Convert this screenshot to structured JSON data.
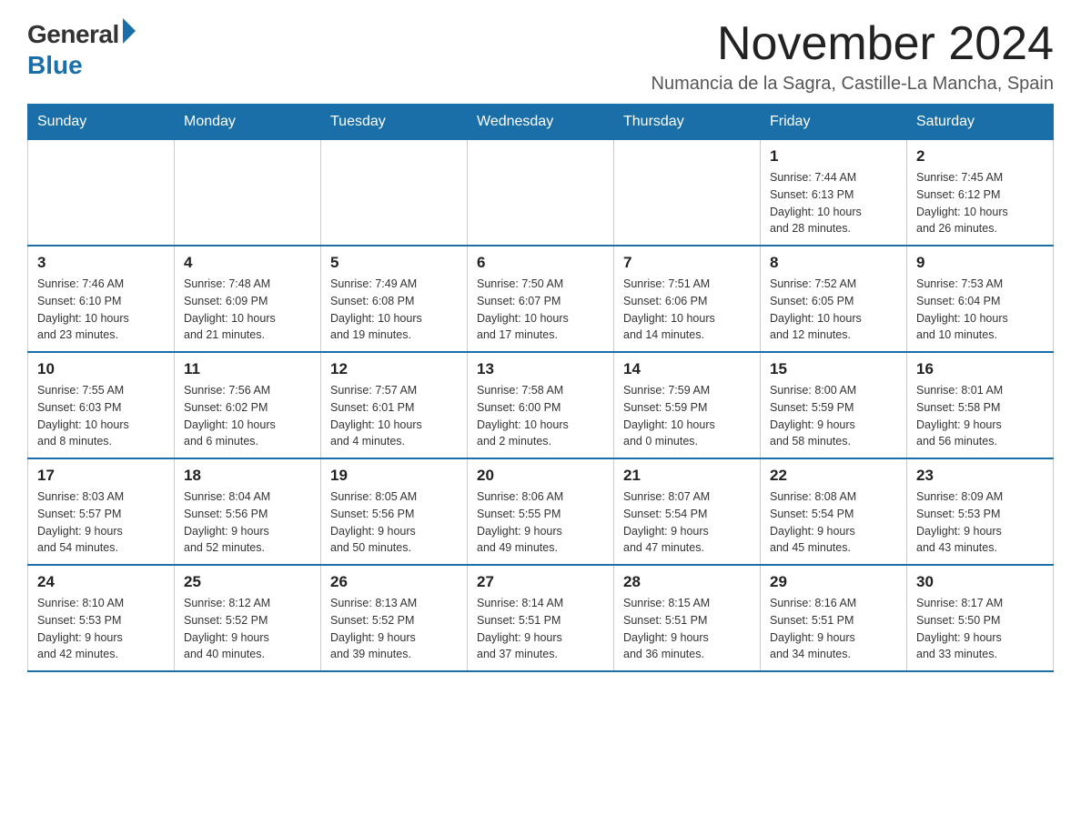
{
  "header": {
    "logo_general": "General",
    "logo_blue": "Blue",
    "main_title": "November 2024",
    "subtitle": "Numancia de la Sagra, Castille-La Mancha, Spain"
  },
  "calendar": {
    "days_of_week": [
      "Sunday",
      "Monday",
      "Tuesday",
      "Wednesday",
      "Thursday",
      "Friday",
      "Saturday"
    ],
    "weeks": [
      {
        "days": [
          {
            "number": "",
            "info": ""
          },
          {
            "number": "",
            "info": ""
          },
          {
            "number": "",
            "info": ""
          },
          {
            "number": "",
            "info": ""
          },
          {
            "number": "",
            "info": ""
          },
          {
            "number": "1",
            "info": "Sunrise: 7:44 AM\nSunset: 6:13 PM\nDaylight: 10 hours\nand 28 minutes."
          },
          {
            "number": "2",
            "info": "Sunrise: 7:45 AM\nSunset: 6:12 PM\nDaylight: 10 hours\nand 26 minutes."
          }
        ]
      },
      {
        "days": [
          {
            "number": "3",
            "info": "Sunrise: 7:46 AM\nSunset: 6:10 PM\nDaylight: 10 hours\nand 23 minutes."
          },
          {
            "number": "4",
            "info": "Sunrise: 7:48 AM\nSunset: 6:09 PM\nDaylight: 10 hours\nand 21 minutes."
          },
          {
            "number": "5",
            "info": "Sunrise: 7:49 AM\nSunset: 6:08 PM\nDaylight: 10 hours\nand 19 minutes."
          },
          {
            "number": "6",
            "info": "Sunrise: 7:50 AM\nSunset: 6:07 PM\nDaylight: 10 hours\nand 17 minutes."
          },
          {
            "number": "7",
            "info": "Sunrise: 7:51 AM\nSunset: 6:06 PM\nDaylight: 10 hours\nand 14 minutes."
          },
          {
            "number": "8",
            "info": "Sunrise: 7:52 AM\nSunset: 6:05 PM\nDaylight: 10 hours\nand 12 minutes."
          },
          {
            "number": "9",
            "info": "Sunrise: 7:53 AM\nSunset: 6:04 PM\nDaylight: 10 hours\nand 10 minutes."
          }
        ]
      },
      {
        "days": [
          {
            "number": "10",
            "info": "Sunrise: 7:55 AM\nSunset: 6:03 PM\nDaylight: 10 hours\nand 8 minutes."
          },
          {
            "number": "11",
            "info": "Sunrise: 7:56 AM\nSunset: 6:02 PM\nDaylight: 10 hours\nand 6 minutes."
          },
          {
            "number": "12",
            "info": "Sunrise: 7:57 AM\nSunset: 6:01 PM\nDaylight: 10 hours\nand 4 minutes."
          },
          {
            "number": "13",
            "info": "Sunrise: 7:58 AM\nSunset: 6:00 PM\nDaylight: 10 hours\nand 2 minutes."
          },
          {
            "number": "14",
            "info": "Sunrise: 7:59 AM\nSunset: 5:59 PM\nDaylight: 10 hours\nand 0 minutes."
          },
          {
            "number": "15",
            "info": "Sunrise: 8:00 AM\nSunset: 5:59 PM\nDaylight: 9 hours\nand 58 minutes."
          },
          {
            "number": "16",
            "info": "Sunrise: 8:01 AM\nSunset: 5:58 PM\nDaylight: 9 hours\nand 56 minutes."
          }
        ]
      },
      {
        "days": [
          {
            "number": "17",
            "info": "Sunrise: 8:03 AM\nSunset: 5:57 PM\nDaylight: 9 hours\nand 54 minutes."
          },
          {
            "number": "18",
            "info": "Sunrise: 8:04 AM\nSunset: 5:56 PM\nDaylight: 9 hours\nand 52 minutes."
          },
          {
            "number": "19",
            "info": "Sunrise: 8:05 AM\nSunset: 5:56 PM\nDaylight: 9 hours\nand 50 minutes."
          },
          {
            "number": "20",
            "info": "Sunrise: 8:06 AM\nSunset: 5:55 PM\nDaylight: 9 hours\nand 49 minutes."
          },
          {
            "number": "21",
            "info": "Sunrise: 8:07 AM\nSunset: 5:54 PM\nDaylight: 9 hours\nand 47 minutes."
          },
          {
            "number": "22",
            "info": "Sunrise: 8:08 AM\nSunset: 5:54 PM\nDaylight: 9 hours\nand 45 minutes."
          },
          {
            "number": "23",
            "info": "Sunrise: 8:09 AM\nSunset: 5:53 PM\nDaylight: 9 hours\nand 43 minutes."
          }
        ]
      },
      {
        "days": [
          {
            "number": "24",
            "info": "Sunrise: 8:10 AM\nSunset: 5:53 PM\nDaylight: 9 hours\nand 42 minutes."
          },
          {
            "number": "25",
            "info": "Sunrise: 8:12 AM\nSunset: 5:52 PM\nDaylight: 9 hours\nand 40 minutes."
          },
          {
            "number": "26",
            "info": "Sunrise: 8:13 AM\nSunset: 5:52 PM\nDaylight: 9 hours\nand 39 minutes."
          },
          {
            "number": "27",
            "info": "Sunrise: 8:14 AM\nSunset: 5:51 PM\nDaylight: 9 hours\nand 37 minutes."
          },
          {
            "number": "28",
            "info": "Sunrise: 8:15 AM\nSunset: 5:51 PM\nDaylight: 9 hours\nand 36 minutes."
          },
          {
            "number": "29",
            "info": "Sunrise: 8:16 AM\nSunset: 5:51 PM\nDaylight: 9 hours\nand 34 minutes."
          },
          {
            "number": "30",
            "info": "Sunrise: 8:17 AM\nSunset: 5:50 PM\nDaylight: 9 hours\nand 33 minutes."
          }
        ]
      }
    ]
  }
}
